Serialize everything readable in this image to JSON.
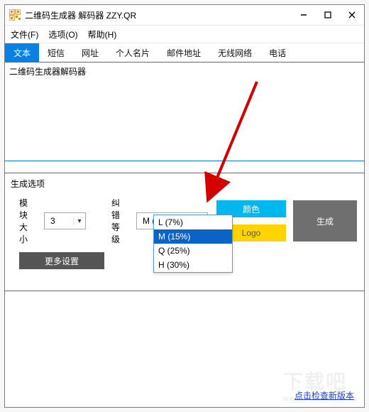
{
  "titlebar": {
    "title": "二维码生成器 解码器 ZZY.QR"
  },
  "menu": {
    "file": "文件(F)",
    "options": "选项(O)",
    "help": "帮助(H)"
  },
  "tabs": {
    "text": "文本",
    "sms": "短信",
    "url": "网址",
    "vcard": "个人名片",
    "email": "邮件地址",
    "wifi": "无线网络",
    "phone": "电话"
  },
  "editor": {
    "text": "二维码生成器解码器"
  },
  "section": {
    "title": "生成选项"
  },
  "labels": {
    "moduleSize": "模块大小",
    "errorLevel": "纠错等级"
  },
  "moduleSize": {
    "value": "3"
  },
  "errorLevel": {
    "value": "M (15%)",
    "options": {
      "l": "L (7%)",
      "m": "M (15%)",
      "q": "Q (25%)",
      "h": "H (30%)"
    }
  },
  "buttons": {
    "color": "颜色",
    "logo": "Logo",
    "generate": "生成",
    "moreSettings": "更多设置"
  },
  "footer": {
    "link": "点击检查新版本"
  },
  "watermark": {
    "main": "下载吧",
    "sub": "www.xiazaiba.com"
  }
}
